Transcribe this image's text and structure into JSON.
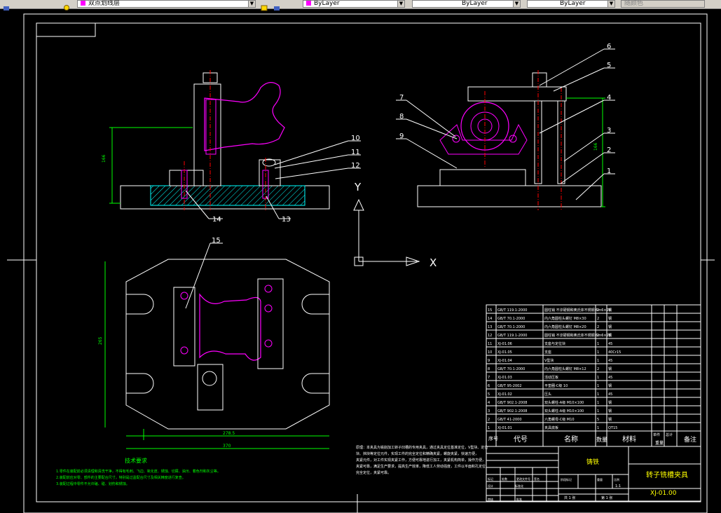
{
  "toolbar": {
    "layer_name": "双点划线层",
    "linetype_label": "ByLayer",
    "lineweight_label": "ByLayer",
    "color_label": "ByLayer",
    "plotstyle_label": "随颜色"
  },
  "drawing": {
    "balloons": [
      "1",
      "2",
      "3",
      "4",
      "5",
      "6",
      "7",
      "8",
      "9",
      "10",
      "11",
      "12",
      "13",
      "14",
      "15"
    ],
    "axis_x": "X",
    "axis_y": "Y",
    "tech_title": "技术要求",
    "tech_lines": [
      "1.零件在装配前必须清理和清洗干净，不得有毛刺、飞边、氧化皮、锈蚀、切屑、油污、着色剂和灰尘等。",
      "2.装配前应对零、部件的主要配合尺寸，特别是过盈配合尺寸及相关精度进行复查。",
      "3.装配过程中零件不允许磕、碰、划伤和锈蚀。"
    ],
    "note_lines": [
      "原理：本夹具为铣削加工转子凹槽的专用夹具，通过夹具定位基准定位，V型块、定位",
      "块、挡块等定位元件，实现工件的完全定位和精确夹紧，螺旋夹紧，快速方便，",
      "夹紧元件，对工件实现夹紧工作，方便可靠地进行加工，夹紧机构简单，操作方便，",
      "夹紧可靠，满足生产要求，提高生产效率，降低工人劳动强度，工件以平面和孔定位",
      "完全定位，夹紧可靠。"
    ],
    "dims": {
      "height": "166",
      "width": "265",
      "inner_width": "278.5",
      "outer_width": "370"
    }
  },
  "bom": {
    "rows": [
      {
        "no": "15",
        "code": "GB/T 119.1-2000",
        "name": "圆柱销 不淬硬钢和奥氏体不锈钢 6m6×26",
        "qty": "2",
        "mat": "钢",
        "note": ""
      },
      {
        "no": "14",
        "code": "GB/T 70.1-2000",
        "name": "内六角圆柱头螺钉 M8×30",
        "qty": "2",
        "mat": "钢",
        "note": ""
      },
      {
        "no": "13",
        "code": "GB/T 70.1-2000",
        "name": "内六角圆柱头螺钉 M8×20",
        "qty": "2",
        "mat": "钢",
        "note": ""
      },
      {
        "no": "12",
        "code": "GB/T 119.1-2000",
        "name": "圆柱销 不淬硬钢和奥氏体不锈钢 6m6×26",
        "qty": "2",
        "mat": "钢",
        "note": ""
      },
      {
        "no": "11",
        "code": "XJ-01.06",
        "name": "支座与定位块",
        "qty": "1",
        "mat": "45",
        "note": ""
      },
      {
        "no": "10",
        "code": "XJ-01.05",
        "name": "支座",
        "qty": "1",
        "mat": "40Cr15",
        "note": ""
      },
      {
        "no": "9",
        "code": "XJ-01.04",
        "name": "V型块",
        "qty": "1",
        "mat": "45",
        "note": ""
      },
      {
        "no": "8",
        "code": "GB/T 70.1-2000",
        "name": "内六角圆柱头螺钉 M8×12",
        "qty": "2",
        "mat": "钢",
        "note": ""
      },
      {
        "no": "7",
        "code": "XJ-01.03",
        "name": "活动压板",
        "qty": "1",
        "mat": "45",
        "note": ""
      },
      {
        "no": "6",
        "code": "GB/T 95-2002",
        "name": "平垫圈-C级 10",
        "qty": "1",
        "mat": "钢",
        "note": ""
      },
      {
        "no": "5",
        "code": "XJ-01.02",
        "name": "压头",
        "qty": "1",
        "mat": "45",
        "note": ""
      },
      {
        "no": "4",
        "code": "GB/T 902.1-2008",
        "name": "双头螺柱-A级 M10×100",
        "qty": "1",
        "mat": "钢",
        "note": ""
      },
      {
        "no": "3",
        "code": "GB/T 902.1-2008",
        "name": "双头螺柱-A级 M10×100",
        "qty": "1",
        "mat": "钢",
        "note": ""
      },
      {
        "no": "2",
        "code": "GB/T 41-2000",
        "name": "六角螺母-C级 M10",
        "qty": "5",
        "mat": "钢",
        "note": ""
      },
      {
        "no": "1",
        "code": "XJ-01.01",
        "name": "夹具底板",
        "qty": "1",
        "mat": "QT15",
        "note": ""
      }
    ],
    "header": {
      "no": "序号",
      "code": "代号",
      "name": "名称",
      "qty": "数量",
      "mat": "材料",
      "single": "单件",
      "total": "总计",
      "weight": "重量",
      "note": "备注"
    }
  },
  "titleblock": {
    "material": "铸铁",
    "title": "转子铣槽夹具",
    "drawing_no": "XJ-01.00",
    "scale": "1:1",
    "sheet": "共 1 张",
    "sheet_no": "第 1 张",
    "labels": [
      "标记",
      "处数",
      "分区",
      "更改文件号",
      "签名",
      "年月日",
      "设计",
      "标准化",
      "审核",
      "工艺",
      "批准",
      "阶段标记",
      "重量",
      "比例"
    ]
  },
  "colors": {
    "bg": "#000000",
    "line": "#ffffff",
    "dim": "#00ff00",
    "part": "#ff00ff",
    "center": "#ff0000",
    "hatch": "#00ffff",
    "text_yellow": "#ffff00"
  }
}
